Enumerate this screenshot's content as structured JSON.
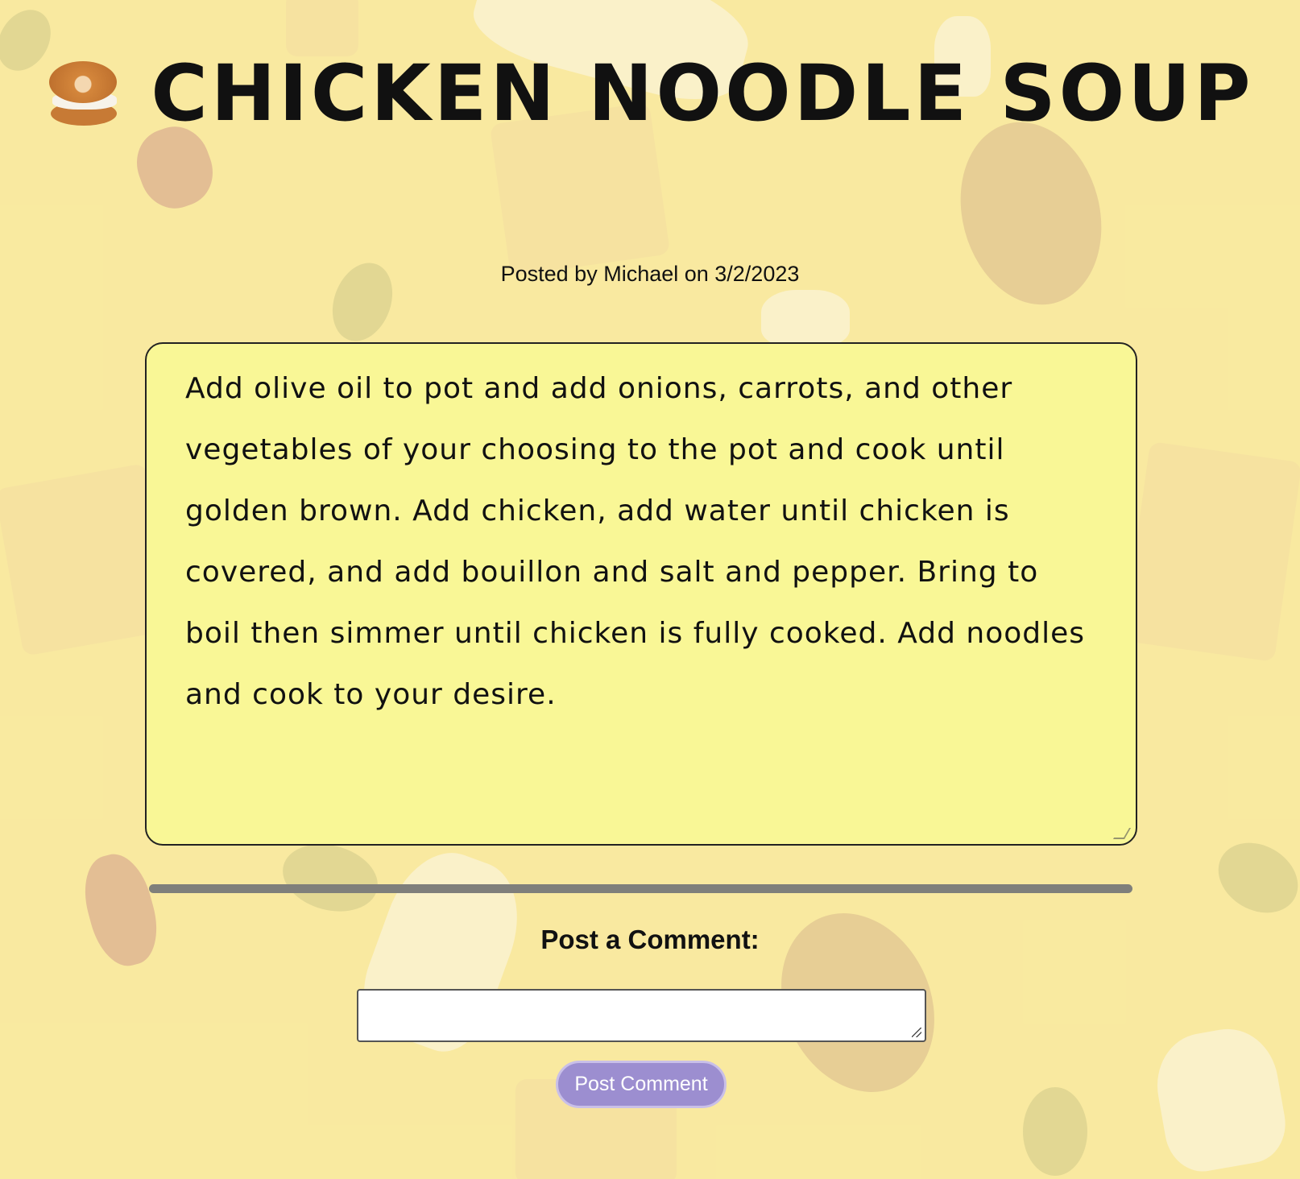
{
  "header": {
    "icon": "bagel-emoji",
    "title": "CHICKEN NOODLE SOUP"
  },
  "post": {
    "meta": "Posted by Michael on 3/2/2023",
    "body": "Add olive oil to pot and add onions, carrots, and other vegetables of your choosing to the pot and cook until golden brown. Add chicken, add water until chicken is covered, and add bouillon and salt and pepper. Bring to boil then simmer until chicken is fully cooked. Add noodles and cook to your desire."
  },
  "comments": {
    "label": "Post a Comment:",
    "input_value": "",
    "button_label": "Post Comment"
  },
  "colors": {
    "background": "#f9e9a0",
    "recipe_box": "#f9f796",
    "button": "#9c8ed0",
    "divider": "#7f7f7b"
  }
}
